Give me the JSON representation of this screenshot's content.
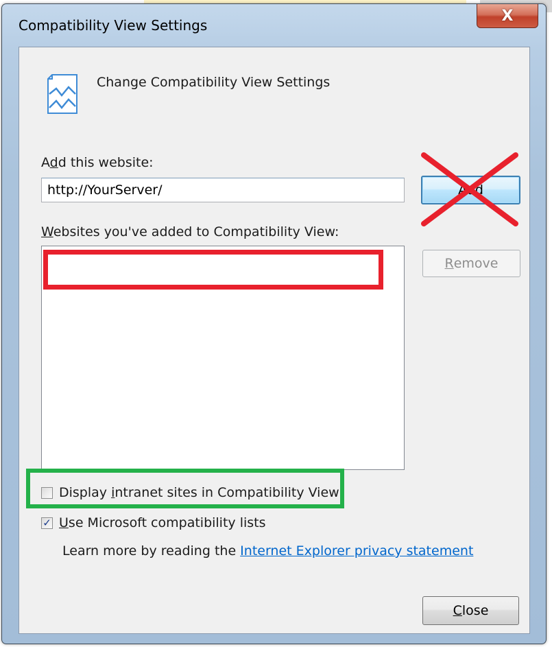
{
  "window": {
    "title": "Compatibility View Settings",
    "close_glyph": "X"
  },
  "header": {
    "icon": "compatibility-view-icon",
    "text": "Change Compatibility View Settings"
  },
  "add_site": {
    "label_pre": "A",
    "label_accel": "d",
    "label_post": "d this website:",
    "value": "http://YourServer/",
    "button_label": "Add"
  },
  "site_list": {
    "label_accel": "W",
    "label_post": "ebsites you've added to Compatibility View:",
    "items": [],
    "remove_accel": "R",
    "remove_post": "emove"
  },
  "options": {
    "intranet": {
      "checked": false,
      "label_pre": "Display ",
      "label_accel": "i",
      "label_post": "ntranet sites in Compatibility View"
    },
    "ms_lists": {
      "checked": true,
      "label_accel": "U",
      "label_post": "se Microsoft compatibility lists"
    }
  },
  "learn_more": {
    "text": "Learn more by reading the ",
    "link": "Internet Explorer privacy statement"
  },
  "footer": {
    "close_accel": "C",
    "close_post": "lose"
  },
  "annotations": {
    "red": "#e8212d",
    "green": "#24b14a"
  }
}
